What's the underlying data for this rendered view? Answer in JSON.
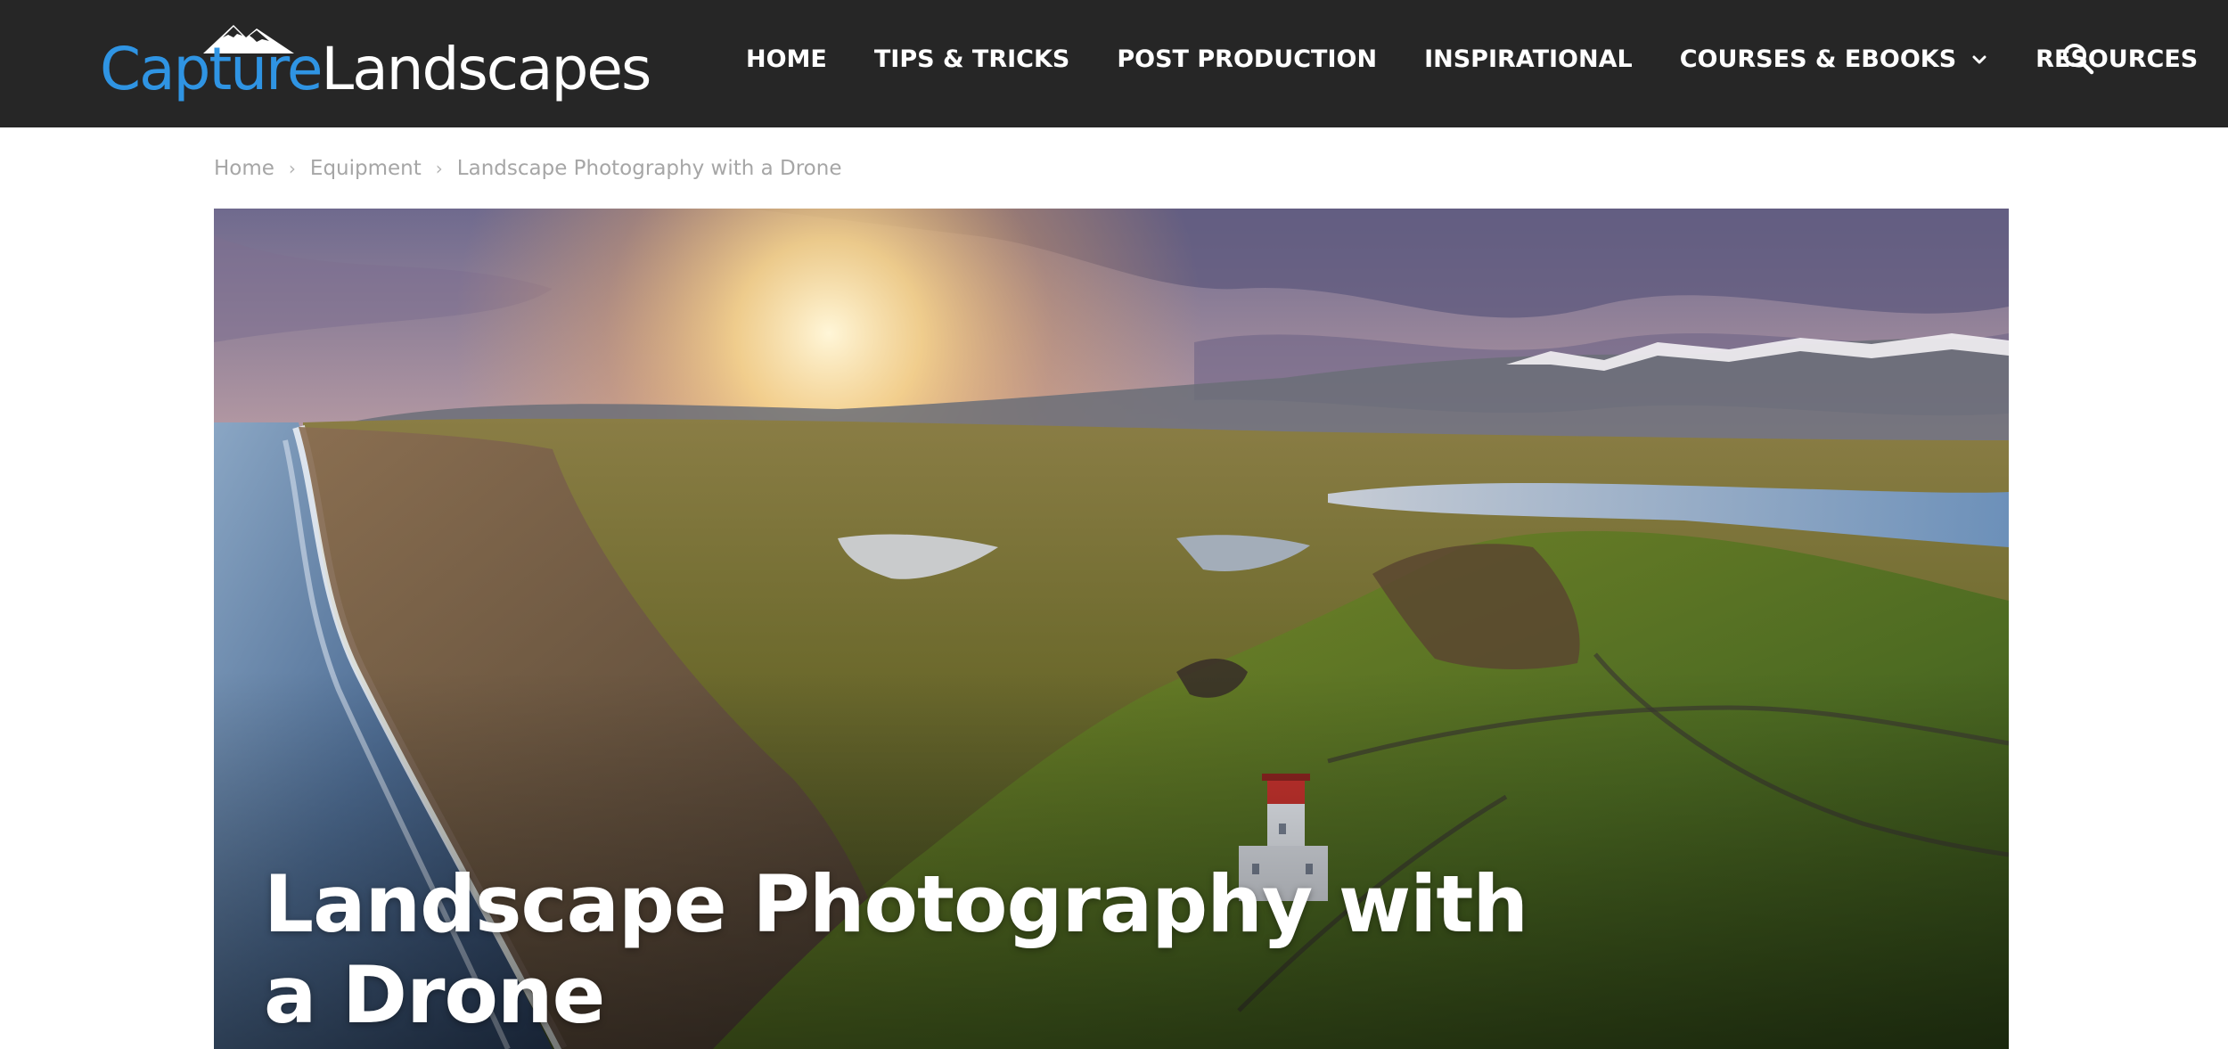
{
  "site": {
    "logo_part1": "Capture",
    "logo_part2": "Landscapes",
    "logo_icon": "mountain-icon",
    "brand_color": "#2f94e3",
    "header_bg": "#262626"
  },
  "nav": {
    "items": [
      {
        "label": "HOME"
      },
      {
        "label": "TIPS & TRICKS"
      },
      {
        "label": "POST PRODUCTION"
      },
      {
        "label": "INSPIRATIONAL"
      },
      {
        "label": "COURSES & EBOOKS",
        "icon": "chevron-down-icon"
      },
      {
        "label": "RESOURCES"
      }
    ],
    "search_icon": "search-icon"
  },
  "breadcrumb": {
    "items": [
      "Home",
      "Equipment",
      "Landscape Photography with a Drone"
    ],
    "separator": "›"
  },
  "article": {
    "title": "Landscape Photography with a Drone"
  }
}
